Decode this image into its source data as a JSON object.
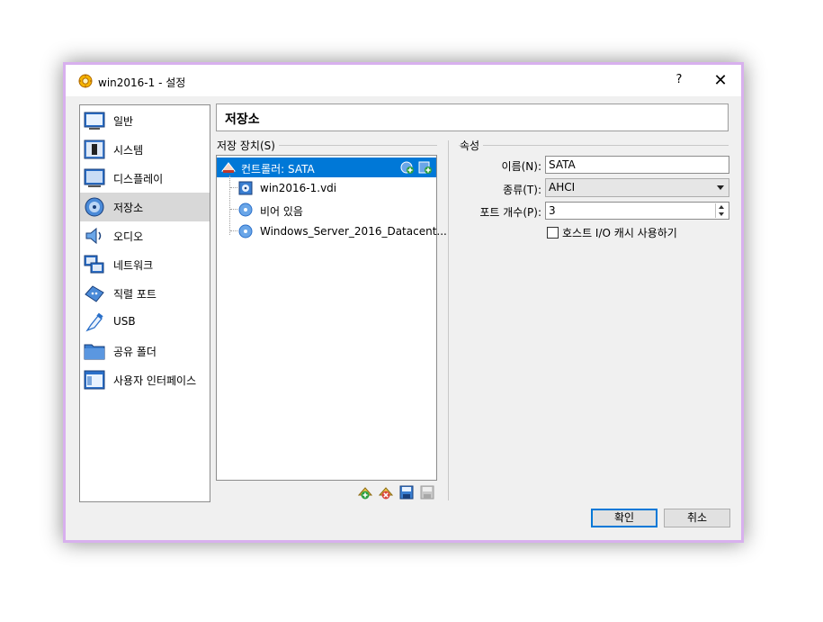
{
  "window": {
    "title": "win2016-1 - 설정",
    "help_label": "?",
    "close_label": "✕"
  },
  "sidebar": {
    "items": [
      {
        "label": "일반",
        "icon": "general-icon"
      },
      {
        "label": "시스템",
        "icon": "system-icon"
      },
      {
        "label": "디스플레이",
        "icon": "display-icon"
      },
      {
        "label": "저장소",
        "icon": "storage-icon",
        "active": true
      },
      {
        "label": "오디오",
        "icon": "audio-icon"
      },
      {
        "label": "네트워크",
        "icon": "network-icon"
      },
      {
        "label": "직렬 포트",
        "icon": "serial-port-icon"
      },
      {
        "label": "USB",
        "icon": "usb-icon"
      },
      {
        "label": "공유 폴더",
        "icon": "shared-folder-icon"
      },
      {
        "label": "사용자 인터페이스",
        "icon": "user-interface-icon"
      }
    ]
  },
  "header": {
    "title": "저장소"
  },
  "storage": {
    "group_label": "저장 장치(S)",
    "controller": "컨트롤러: SATA",
    "devices": [
      {
        "label": "win2016-1.vdi",
        "icon": "hard-disk-icon"
      },
      {
        "label": "비어 있음",
        "icon": "optical-disc-icon"
      },
      {
        "label": "Windows_Server_2016_Datacent...",
        "icon": "optical-disc-icon"
      }
    ]
  },
  "attributes": {
    "group_label": "속성",
    "name_label": "이름(N):",
    "name_value": "SATA",
    "type_label": "종류(T):",
    "type_value": "AHCI",
    "port_count_label": "포트 개수(P):",
    "port_count_value": "3",
    "host_cache_label": "호스트 I/O 캐시 사용하기",
    "host_cache_checked": false
  },
  "buttons": {
    "ok": "확인",
    "cancel": "취소"
  },
  "colors": {
    "selection": "#0078d7",
    "window_border": "#d8b0ee",
    "background": "#f0f0f0"
  }
}
